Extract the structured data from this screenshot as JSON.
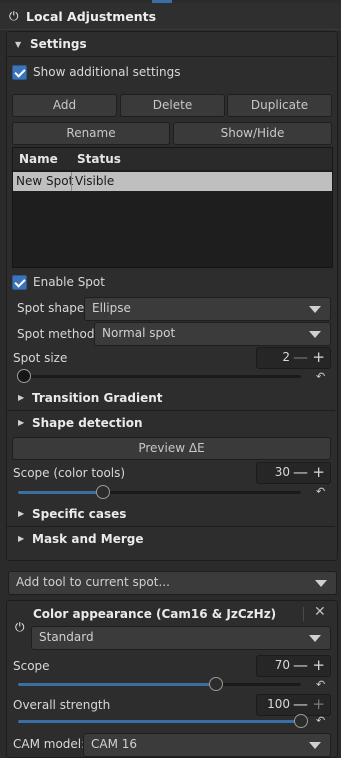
{
  "header": {
    "title": "Local Adjustments"
  },
  "settings": {
    "title": "Settings",
    "show_additional": "Show additional settings",
    "buttons": {
      "add": "Add",
      "delete": "Delete",
      "duplicate": "Duplicate",
      "rename": "Rename",
      "show_hide": "Show/Hide"
    },
    "list": {
      "headers": [
        "Name",
        "Status"
      ],
      "rows": [
        {
          "name": "New Spot",
          "status": "Visible"
        }
      ]
    },
    "enable_spot": "Enable Spot",
    "spot_shape": {
      "label": "Spot shape:",
      "value": "Ellipse"
    },
    "spot_method": {
      "label": "Spot method:",
      "value": "Normal spot"
    },
    "spot_size": {
      "label": "Spot size",
      "value": "2",
      "level_fraction": 0.0
    },
    "transition_gradient": "Transition Gradient",
    "shape_detection": "Shape detection",
    "preview_button": "Preview ΔE",
    "scope_color": {
      "label": "Scope (color tools)",
      "value": "30",
      "level_fraction": 0.3
    },
    "specific_cases": "Specific cases",
    "mask_merge": "Mask and Merge"
  },
  "add_tool": {
    "placeholder": "Add tool to current spot..."
  },
  "color_appearance": {
    "title": "Color appearance (Cam16 & JzCzHz)",
    "mode": "Standard",
    "scope": {
      "label": "Scope",
      "value": "70",
      "level_fraction": 0.7
    },
    "overall_strength": {
      "label": "Overall strength",
      "value": "100",
      "level_fraction": 1.0
    },
    "cam_model": {
      "label": "CAM model:",
      "value": "CAM 16"
    }
  },
  "colors": {
    "accent": "#3a6ea5",
    "checkbox": "#3b74b8",
    "background": "#2b2b2b",
    "selected_row": "#bfbfbf"
  }
}
